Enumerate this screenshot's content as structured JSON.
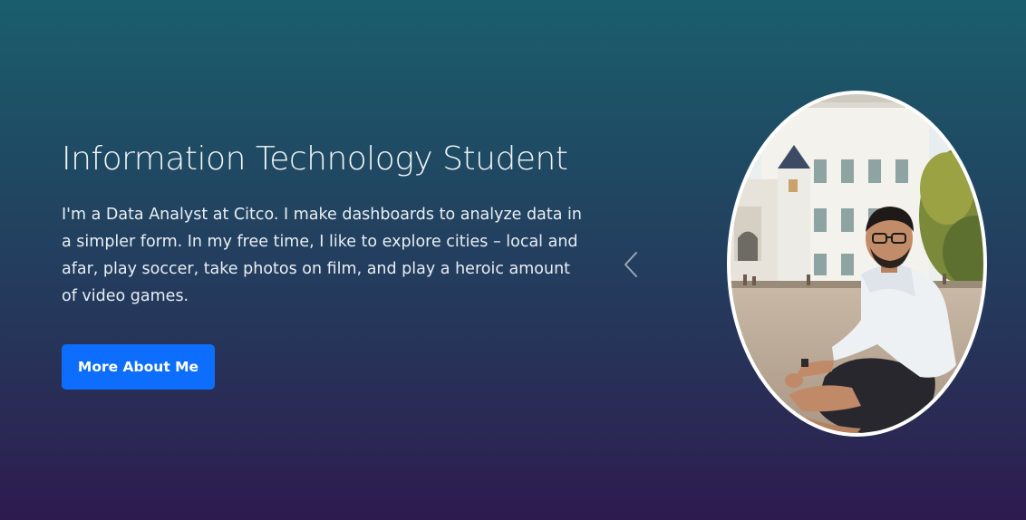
{
  "hero": {
    "title": "Information Technology Student",
    "description": "I'm a Data Analyst at Citco. I make dashboards to analyze data in a simpler form. In my free time, I like to explore cities – local and afar, play soccer, take photos on film, and play a heroic amount of video games.",
    "cta_label": "More About Me"
  },
  "carousel": {
    "prev_icon": "chevron-left-icon"
  },
  "colors": {
    "gradient_top": "#1a5e6c",
    "gradient_bottom": "#2d1a4f",
    "button": "#0d6efd",
    "text": "#ffffff"
  }
}
